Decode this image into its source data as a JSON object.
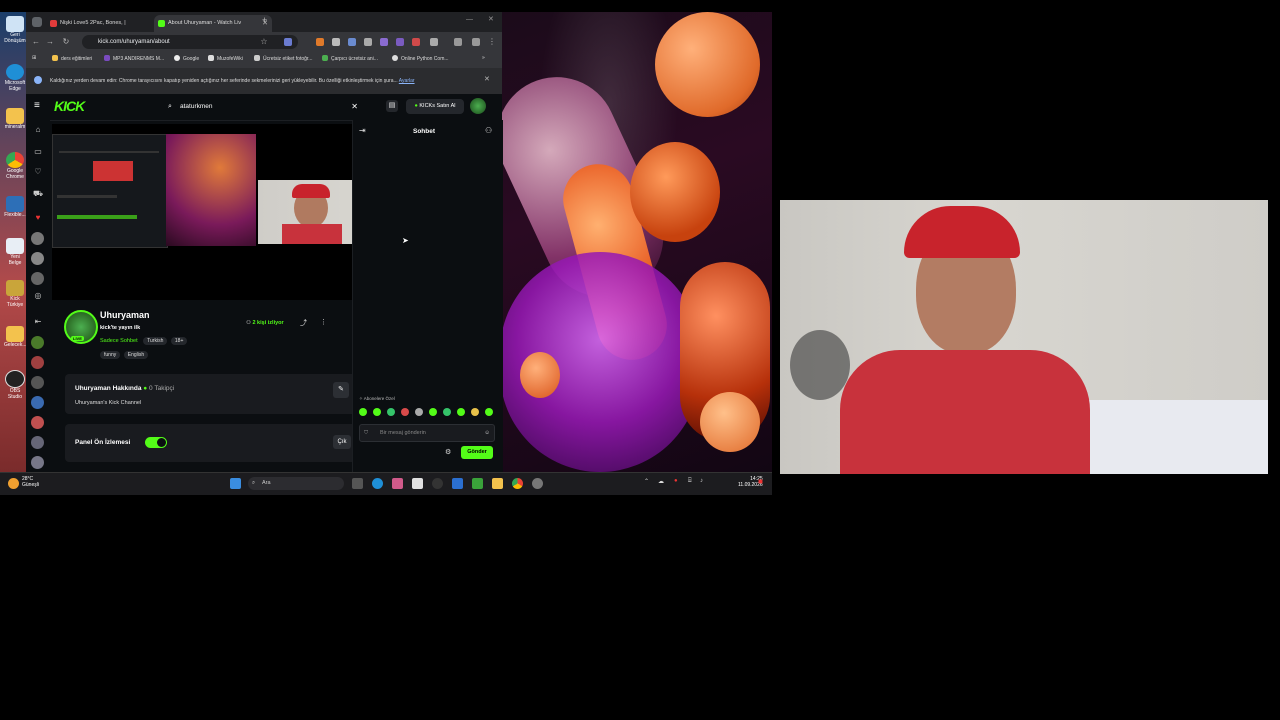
{
  "browser": {
    "tabs": [
      {
        "label": "Nişki Love5 2Pac, Bones, |"
      },
      {
        "label": "About Uhuryaman - Watch Liv"
      }
    ],
    "url": "kick.com/uhuryaman/about",
    "bookmarks": [
      "ders eğitimleri",
      "MP3 ANDIRENMS M...",
      "Google",
      "MuzofeWiki",
      "Ücretsiz etiket fotoğr...",
      "Çarpıcı ücretsiz ani...",
      "Online Python Com..."
    ],
    "infobar": {
      "text": "Kaldığınız yerden devam edin: Chrome tarayıcısını kapatıp yeniden açtığınız her seferinde sekmelerinizi geri yükleyebilir. Bu özelliği etkinleştirmek için şura...",
      "link": "Ayarlar"
    }
  },
  "kick": {
    "logo": "KICK",
    "search_value": "ataturkmen",
    "kicks_button": "KICKs Satın Al",
    "chat_title": "Sohbet",
    "streamer": {
      "name": "Uhuryaman",
      "subtitle": "kick'te yayın ilk",
      "category": "Sadece Sohbet",
      "live_badge": "LIVE",
      "tags": [
        "Turkish",
        "18+",
        "funny",
        "English"
      ],
      "viewers": "2 kişi izliyor"
    },
    "about": {
      "title": "Uhuryaman Hakkında",
      "followers": "0 Takipçi",
      "description": "Uhuryaman's Kick Channel"
    },
    "preview": {
      "label": "Panel Ön İzlemesi",
      "button": "Çık"
    },
    "chat": {
      "subs_label": "Abonelere Özel",
      "placeholder": "Bir mesaj gönderin",
      "send": "Gönder"
    }
  },
  "desktop_icons": [
    "Geri Dönüşüm",
    "Microsoft Edge",
    "mineralm",
    "Google Chrome",
    "Flexible...",
    "Yeni Belge",
    "Kick Türkiye",
    "Gelecek...",
    "OBS Studio"
  ],
  "taskbar": {
    "weather_temp": "28°C",
    "weather_desc": "Güneşli",
    "search": "Ara",
    "time": "14:25",
    "date": "11.09.2026"
  },
  "colors": {
    "accent": "#53fc18",
    "background": "#0b0e11"
  }
}
